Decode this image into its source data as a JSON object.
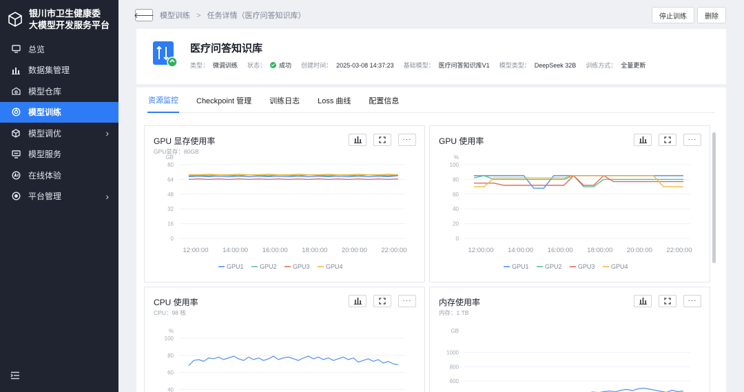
{
  "app": {
    "title_line1": "银川市卫生健康委",
    "title_line2": "大模型开发服务平台"
  },
  "sidebar": {
    "items": [
      {
        "label": "总览",
        "icon": "monitor-icon",
        "active": false,
        "has_children": false
      },
      {
        "label": "数据集管理",
        "icon": "bar-chart-icon",
        "active": false,
        "has_children": false
      },
      {
        "label": "模型仓库",
        "icon": "model-repo-icon",
        "active": false,
        "has_children": false
      },
      {
        "label": "模型训练",
        "icon": "training-icon",
        "active": true,
        "has_children": false
      },
      {
        "label": "模型调优",
        "icon": "cube-icon",
        "active": false,
        "has_children": true
      },
      {
        "label": "模型服务",
        "icon": "service-icon",
        "active": false,
        "has_children": false
      },
      {
        "label": "在线体验",
        "icon": "ai-experience-icon",
        "active": false,
        "has_children": false
      },
      {
        "label": "平台管理",
        "icon": "target-icon",
        "active": false,
        "has_children": true
      }
    ]
  },
  "breadcrumb": {
    "items": [
      "模型训练",
      "任务详情（医疗问答知识库）"
    ],
    "separator": ">"
  },
  "actions": {
    "stop": "停止训练",
    "delete": "删除"
  },
  "task": {
    "title": "医疗问答知识库",
    "meta": [
      {
        "key": "类型：",
        "value": "微调训练"
      },
      {
        "key": "状态：",
        "value": "成功",
        "status": "success"
      },
      {
        "key": "创建时间：",
        "value": "2025-03-08 14:37:23"
      },
      {
        "key": "基础模型：",
        "value": "医疗问答知识库V1"
      },
      {
        "key": "模型类型：",
        "value": "DeepSeek 32B"
      },
      {
        "key": "训练方式：",
        "value": "全量更新"
      }
    ]
  },
  "tabs": [
    {
      "label": "资源监控",
      "active": true
    },
    {
      "label": "Checkpoint 管理",
      "active": false
    },
    {
      "label": "训练日志",
      "active": false
    },
    {
      "label": "Loss 曲线",
      "active": false
    },
    {
      "label": "配置信息",
      "active": false
    }
  ],
  "colors": {
    "accent": "#2d7cf6",
    "gpu1": "#4e91ee",
    "gpu2": "#58c38d",
    "gpu3": "#e06a5c",
    "gpu4": "#f1b740"
  },
  "panels": [
    {
      "title": "GPU 显存使用率",
      "subtitle": "GPU显存：80GB",
      "chart_data": {
        "type": "line",
        "ylabel": "GB",
        "ylim": [
          0,
          80
        ],
        "yticks": [
          0,
          16,
          32,
          48,
          64,
          80
        ],
        "xticks": [
          "12:00:00",
          "14:00:00",
          "16:00:00",
          "18:00:00",
          "20:00:00",
          "22:00:00"
        ],
        "legend_position": "bottom",
        "series": [
          {
            "name": "GPU1",
            "values": [
              67,
              67.5,
              67,
              67.5,
              67,
              67.5,
              67,
              67.5,
              67,
              67.5,
              67,
              67.5,
              67,
              67.5,
              67,
              67.5,
              67,
              67.5,
              67,
              67.5,
              67,
              68
            ]
          },
          {
            "name": "GPU2",
            "values": [
              68,
              68.5,
              68,
              69,
              68.5,
              68,
              69,
              68.5,
              68,
              69,
              68.5,
              68,
              69,
              68.5,
              68,
              69,
              68.5,
              68,
              69,
              68.5,
              68,
              69
            ]
          },
          {
            "name": "GPU3",
            "values": [
              64,
              64.5,
              64,
              64.5,
              64,
              64.5,
              64,
              64.5,
              64,
              64.5,
              64,
              64.5,
              64,
              64.5,
              64,
              64.5,
              64,
              64.5,
              64,
              64.5,
              64,
              64.5
            ]
          },
          {
            "name": "GPU4",
            "values": [
              69,
              69,
              69.5,
              69,
              69,
              69.5,
              69,
              69,
              69.5,
              69,
              69,
              69.5,
              69,
              69,
              69.5,
              69,
              69,
              69.5,
              69,
              69,
              69.5,
              69
            ]
          }
        ]
      }
    },
    {
      "title": "GPU 使用率",
      "subtitle": "",
      "chart_data": {
        "type": "line",
        "ylabel": "%",
        "ylim": [
          0,
          100
        ],
        "yticks": [
          0,
          20,
          40,
          60,
          80,
          100
        ],
        "xticks": [
          "12:00:00",
          "14:00:00",
          "16:00:00",
          "18:00:00",
          "20:00:00",
          "22:00:00"
        ],
        "legend_position": "bottom",
        "series": [
          {
            "name": "GPU1",
            "values": [
              85,
              85,
              85,
              85,
              85,
              85,
              68,
              68,
              85,
              85,
              85,
              85,
              85,
              85,
              85,
              85,
              85,
              85,
              85,
              85,
              85,
              85
            ]
          },
          {
            "name": "GPU2",
            "values": [
              82,
              85,
              80,
              80,
              80,
              80,
              80,
              80,
              80,
              80,
              85,
              70,
              70,
              80,
              80,
              80,
              80,
              80,
              80,
              80,
              80,
              80
            ]
          },
          {
            "name": "GPU3",
            "values": [
              75,
              75,
              75,
              72,
              72,
              72,
              72,
              72,
              72,
              72,
              85,
              72,
              72,
              85,
              77,
              77,
              77,
              77,
              77,
              77,
              77,
              77
            ]
          },
          {
            "name": "GPU4",
            "values": [
              70,
              70,
              82,
              82,
              82,
              82,
              82,
              82,
              82,
              82,
              85,
              85,
              85,
              85,
              85,
              85,
              85,
              85,
              85,
              70,
              70,
              70
            ]
          }
        ]
      }
    },
    {
      "title": "CPU 使用率",
      "subtitle": "CPU：98 核",
      "chart_data": {
        "type": "line",
        "ylabel": "%",
        "ylim": [
          0,
          100
        ],
        "yticks": [
          40,
          60,
          80,
          100
        ],
        "series": [
          {
            "name": "CPU",
            "values": [
              68,
              74,
              75,
              73,
              77,
              76,
              78,
              75,
              77,
              79,
              76,
              74,
              78,
              75,
              77,
              74,
              76,
              79,
              75,
              77,
              78,
              76,
              74,
              77,
              79,
              76,
              78,
              75,
              77,
              74,
              76,
              78,
              75,
              77,
              72,
              74,
              76,
              73,
              75,
              71,
              73,
              70,
              69
            ]
          }
        ]
      }
    },
    {
      "title": "内存使用率",
      "subtitle": "内存：1 TB",
      "chart_data": {
        "type": "line",
        "ylabel": "GB",
        "ylim": [
          0,
          1200
        ],
        "yticks": [
          400,
          600,
          800,
          1000
        ],
        "series": [
          {
            "name": "内存",
            "values": [
              360,
              380,
              395,
              405,
              410,
              398,
              412,
              405,
              420,
              415,
              408,
              418,
              425,
              412,
              420,
              430,
              418,
              425,
              440,
              428,
              432,
              445,
              438,
              450,
              460,
              448,
              470,
              480,
              465,
              490,
              500,
              485,
              470,
              455,
              440,
              470,
              450,
              460
            ]
          }
        ]
      }
    }
  ]
}
